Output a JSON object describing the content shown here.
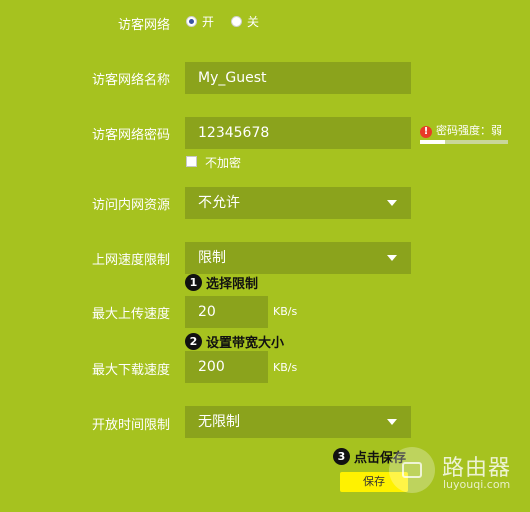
{
  "guest_network": {
    "label": "访客网络",
    "on_label": "开",
    "off_label": "关",
    "value": "on"
  },
  "guest_network_name": {
    "label": "访客网络名称",
    "value": "My_Guest"
  },
  "guest_network_password": {
    "label": "访客网络密码",
    "value": "12345678",
    "strength_text": "密码强度：弱",
    "strength_level": 0.28,
    "no_encrypt_label": "不加密"
  },
  "intranet_access": {
    "label": "访问内网资源",
    "value": "不允许"
  },
  "speed_limit": {
    "label": "上网速度限制",
    "value": "限制"
  },
  "max_upload": {
    "label": "最大上传速度",
    "value": "20",
    "unit": "KB/s"
  },
  "max_download": {
    "label": "最大下载速度",
    "value": "200",
    "unit": "KB/s"
  },
  "open_time_limit": {
    "label": "开放时间限制",
    "value": "无限制"
  },
  "steps": [
    {
      "num": "1",
      "text": "选择限制"
    },
    {
      "num": "2",
      "text": "设置带宽大小"
    },
    {
      "num": "3",
      "text": "点击保存"
    }
  ],
  "save_button_label": "保存",
  "watermark": {
    "title": "路由器",
    "url": "luyouqi.com"
  },
  "colors": {
    "background": "#a6c21f",
    "field": "#8ba31c",
    "save_button": "#fff200",
    "warning": "#e83a28"
  }
}
